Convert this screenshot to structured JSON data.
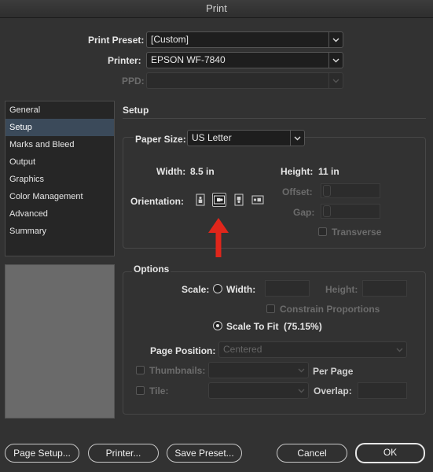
{
  "window": {
    "title": "Print"
  },
  "preset": {
    "label": "Print Preset:",
    "value": "[Custom]"
  },
  "printer": {
    "label": "Printer:",
    "value": "EPSON WF-7840"
  },
  "ppd": {
    "label": "PPD:",
    "value": ""
  },
  "sidebar": {
    "items": [
      {
        "label": "General",
        "selected": false
      },
      {
        "label": "Setup",
        "selected": true
      },
      {
        "label": "Marks and Bleed",
        "selected": false
      },
      {
        "label": "Output",
        "selected": false
      },
      {
        "label": "Graphics",
        "selected": false
      },
      {
        "label": "Color Management",
        "selected": false
      },
      {
        "label": "Advanced",
        "selected": false
      },
      {
        "label": "Summary",
        "selected": false
      }
    ]
  },
  "setup": {
    "title": "Setup",
    "paper_size_label": "Paper Size:",
    "paper_size_value": "US Letter",
    "width_label": "Width:",
    "width_value": "8.5 in",
    "height_label": "Height:",
    "height_value": "11 in",
    "orientation_label": "Orientation:",
    "orientation_selected": "landscape",
    "offset_label": "Offset:",
    "gap_label": "Gap:",
    "transverse_label": "Transverse"
  },
  "options": {
    "title": "Options",
    "scale_label": "Scale:",
    "width_label": "Width:",
    "height_label": "Height:",
    "constrain_label": "Constrain Proportions",
    "scale_to_fit_label": "Scale To Fit",
    "scale_to_fit_value": "(75.15%)",
    "page_position_label": "Page Position:",
    "page_position_value": "Centered",
    "thumbnails_label": "Thumbnails:",
    "per_page_label": "Per Page",
    "tile_label": "Tile:",
    "overlap_label": "Overlap:"
  },
  "buttons": {
    "page_setup": "Page Setup...",
    "printer": "Printer...",
    "save_preset": "Save Preset...",
    "cancel": "Cancel",
    "ok": "OK"
  },
  "annotation": {
    "arrow_color": "#e0261b"
  },
  "icons": {
    "dropdown": "chevron-down-icon",
    "orientation": [
      "portrait-icon",
      "landscape-icon",
      "reverse-portrait-icon",
      "reverse-landscape-icon"
    ]
  }
}
